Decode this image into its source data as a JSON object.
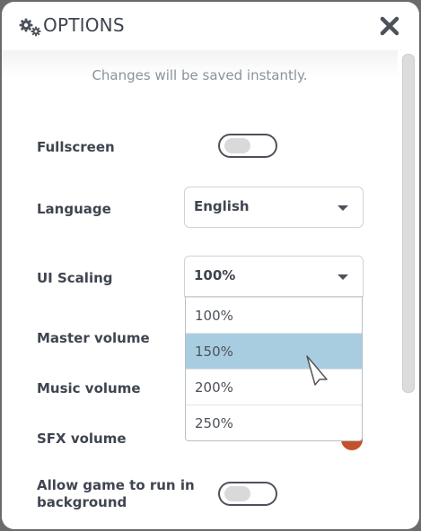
{
  "window": {
    "title": "OPTIONS",
    "title_icon": "gears-icon",
    "close_icon": "close-icon"
  },
  "notice": "Changes will be saved instantly.",
  "settings": {
    "fullscreen": {
      "label": "Fullscreen",
      "enabled": false
    },
    "language": {
      "label": "Language",
      "value": "English"
    },
    "ui_scaling": {
      "label": "UI Scaling",
      "value": "100%",
      "options": [
        "100%",
        "150%",
        "200%",
        "250%"
      ],
      "highlighted": "150%"
    },
    "master_volume": {
      "label": "Master volume"
    },
    "music_volume": {
      "label": "Music volume"
    },
    "sfx_volume": {
      "label": "SFX volume"
    },
    "background": {
      "label": "Allow game to run in background",
      "enabled": false
    }
  },
  "colors": {
    "text": "#3f4550",
    "muted": "#8a929c",
    "highlight": "#a9cde0",
    "slider_accent": "#c4512e"
  }
}
